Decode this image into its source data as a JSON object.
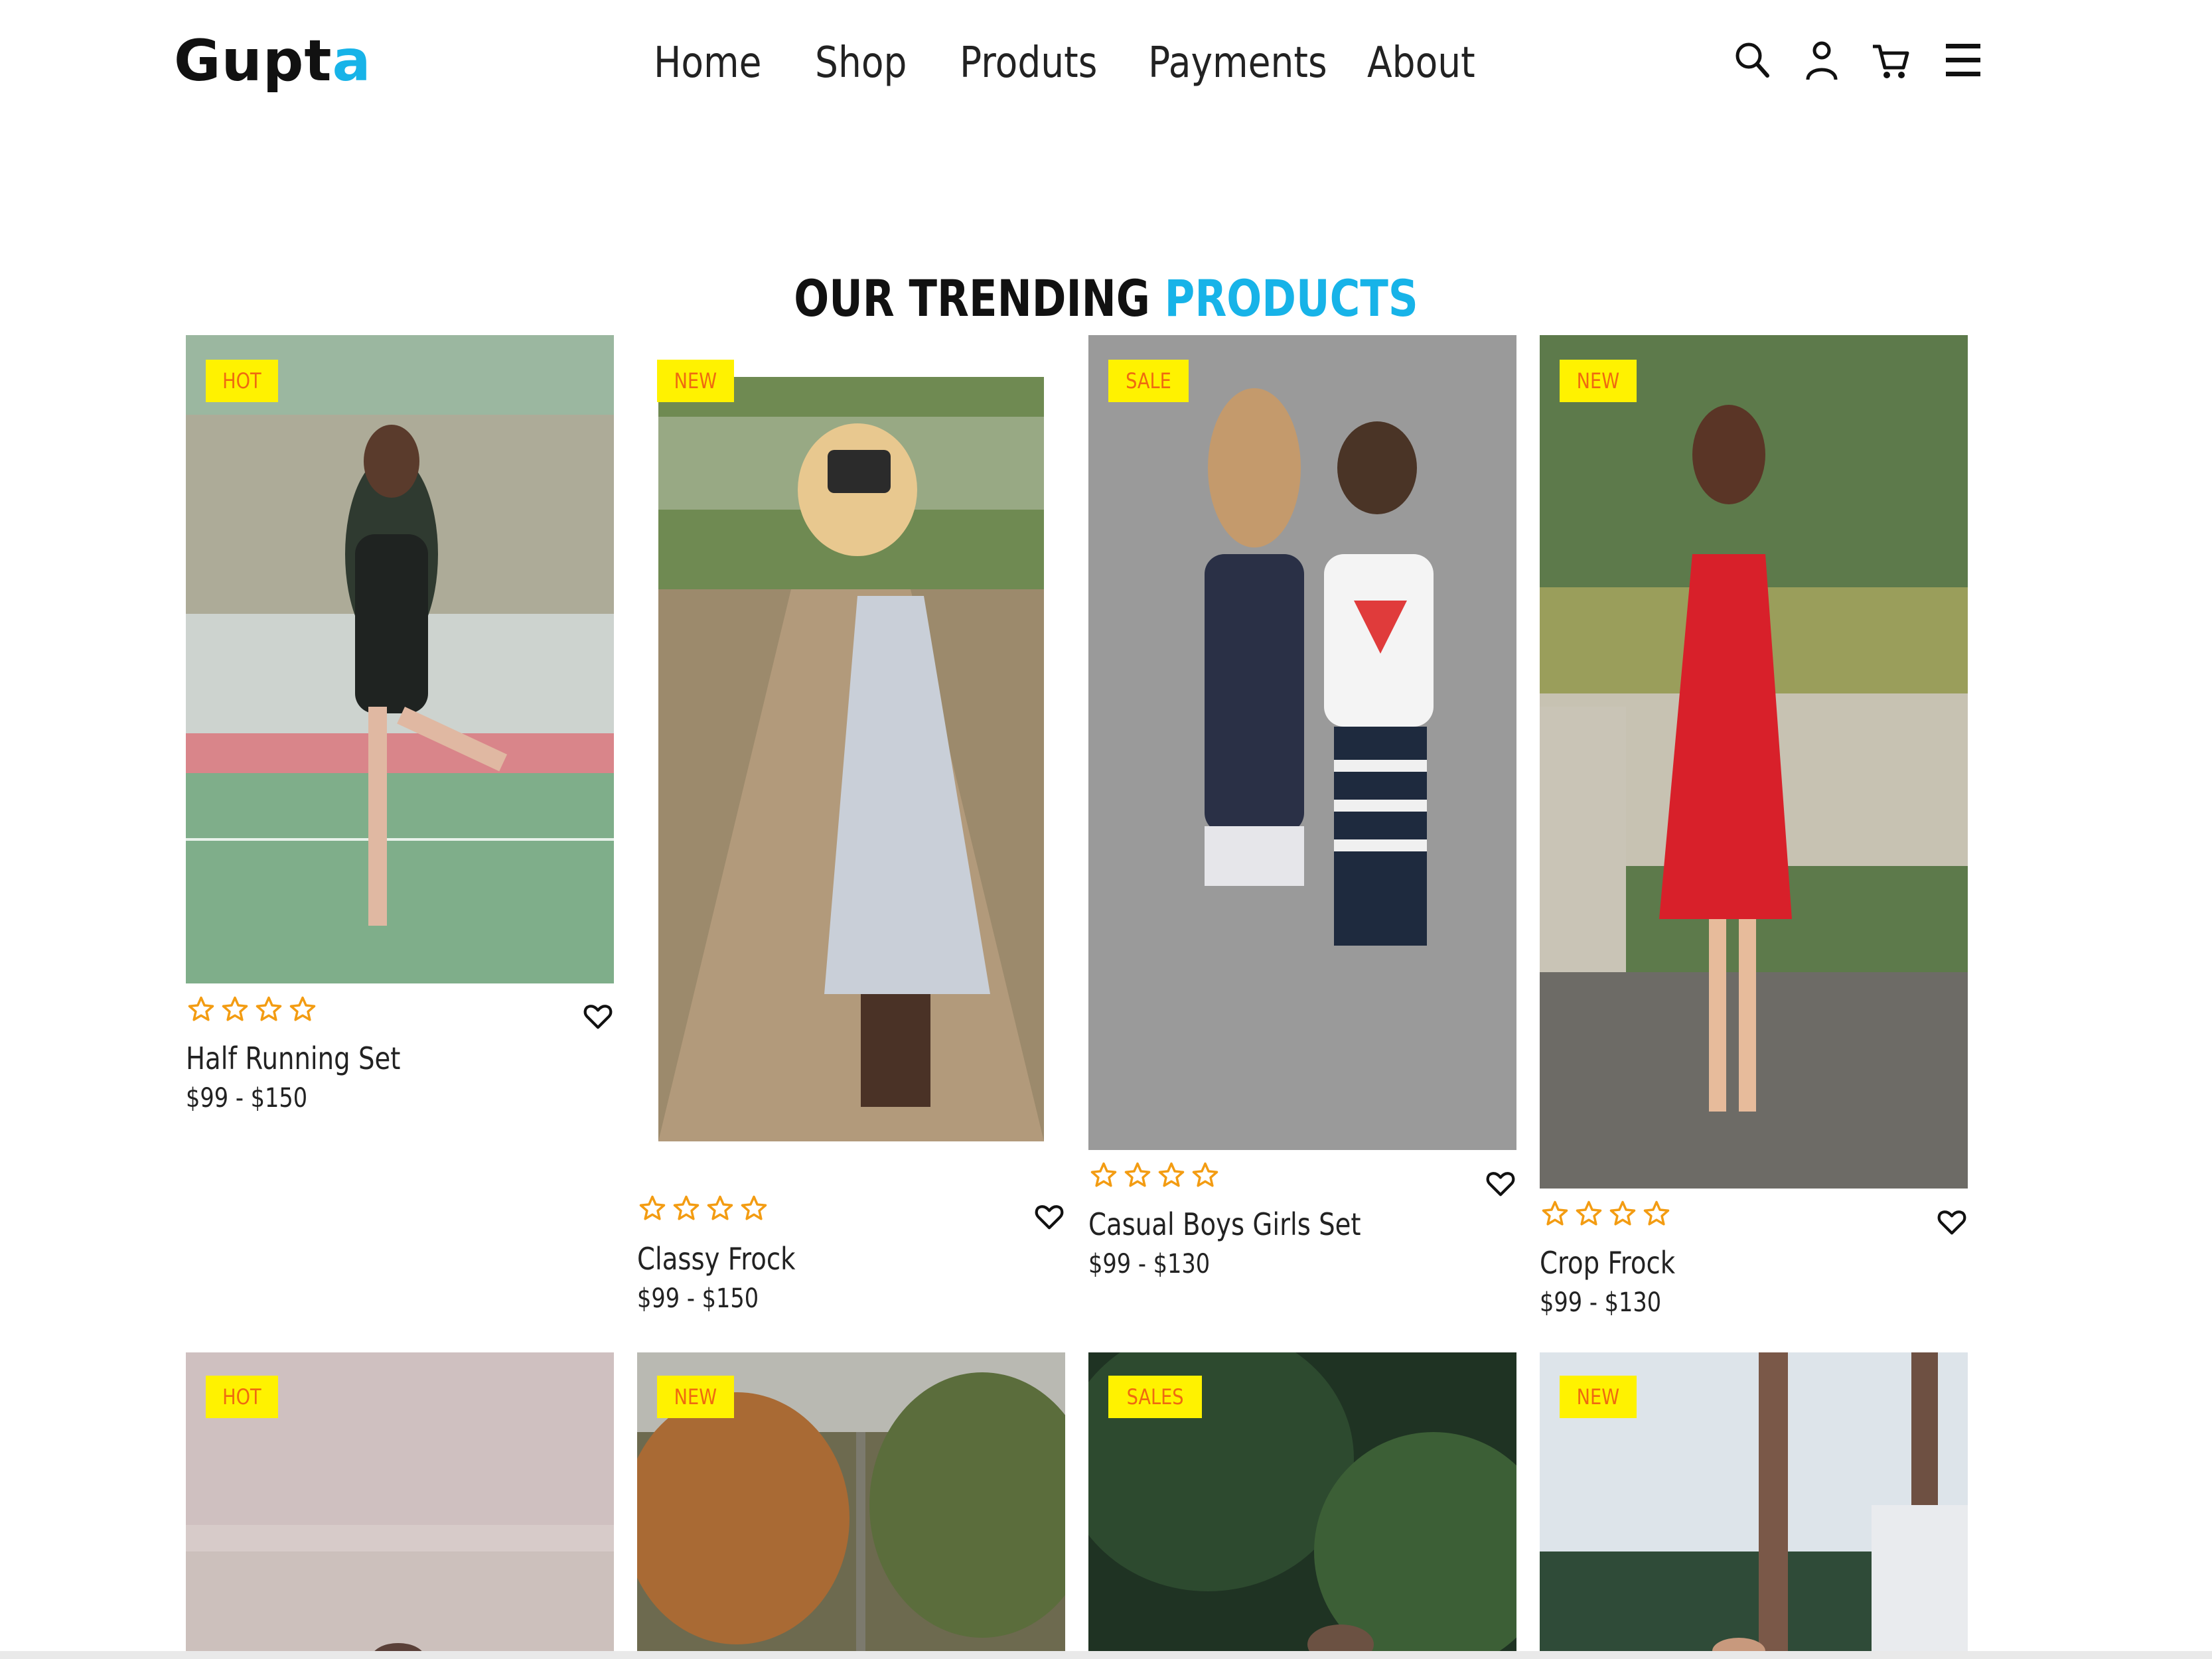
{
  "header": {
    "logo_main": "Gupt",
    "logo_accent": "a",
    "nav": [
      "Home",
      "Shop",
      "Produts",
      "Payments",
      "About"
    ],
    "icons": [
      "search-icon",
      "user-icon",
      "cart-icon",
      "menu-icon"
    ]
  },
  "section": {
    "title_main": "OUR TRENDING ",
    "title_accent": "PRODUCTS"
  },
  "colors": {
    "accent": "#17b3e8",
    "badge_bg": "#fff200",
    "badge_text": "#ef6a10",
    "star": "#f39c12"
  },
  "products": [
    {
      "badge": "HOT",
      "name": "Half Running Set",
      "price": "$99 - $150",
      "rating": 4
    },
    {
      "badge": "NEW",
      "name": "Classy Frock",
      "price": "$99 - $150",
      "rating": 4
    },
    {
      "badge": "SALE",
      "name": "Casual Boys Girls Set",
      "price": "$99 - $130",
      "rating": 4
    },
    {
      "badge": "NEW",
      "name": "Crop Frock",
      "price": "$99 - $130",
      "rating": 4
    },
    {
      "badge": "HOT"
    },
    {
      "badge": "NEW"
    },
    {
      "badge": "SALES"
    },
    {
      "badge": "NEW"
    }
  ]
}
